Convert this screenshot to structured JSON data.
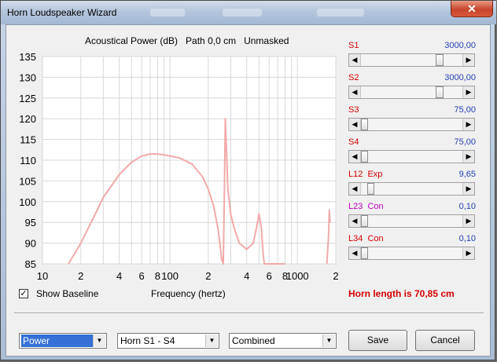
{
  "window": {
    "title": "Horn Loudspeaker Wizard",
    "close_glyph": "✕"
  },
  "chart": {
    "title_line": "Acoustical Power (dB)   Path 0,0 cm   Unmasked",
    "ytick_labels": [
      "135",
      "130",
      "125",
      "120",
      "115",
      "110",
      "105",
      "100",
      "95",
      "90",
      "85"
    ],
    "xtick_labels": [
      "10",
      "2",
      "4",
      "6",
      "8",
      "100",
      "2",
      "4",
      "6",
      "8",
      "1000",
      "2"
    ],
    "curve_color": "#f2a9a9"
  },
  "chart_data": {
    "type": "line",
    "xlabel": "Frequency (hertz)",
    "ylabel": "",
    "xscale": "log",
    "xlim": [
      10,
      2000
    ],
    "ylim": [
      85,
      135
    ],
    "grid": true,
    "series": [
      {
        "x": [
          16,
          20,
          25,
          30,
          40,
          50,
          60,
          70,
          80,
          90,
          100,
          120,
          150,
          180,
          200,
          220,
          240,
          255,
          262,
          268,
          272,
          278,
          285,
          300,
          320,
          350,
          400,
          450,
          480,
          500,
          520,
          540,
          550,
          560,
          570,
          600,
          700,
          800
        ],
        "y": [
          85,
          90,
          96,
          101,
          106.5,
          109.5,
          111,
          111.5,
          111.5,
          111.3,
          111,
          110.5,
          109,
          106,
          103,
          99,
          93,
          86,
          85,
          104,
          120,
          112,
          103,
          97,
          93.5,
          90,
          88.5,
          90,
          94,
          97,
          94,
          87,
          85,
          85,
          85,
          85,
          85,
          85
        ]
      },
      {
        "x": [
          1700,
          1750,
          1780,
          1800
        ],
        "y": [
          85,
          91,
          98,
          95
        ]
      }
    ]
  },
  "sliders": [
    {
      "label": "S1",
      "value": "3000,00",
      "label_color": "#d40000",
      "fraction": 0.79
    },
    {
      "label": "S2",
      "value": "3000,00",
      "label_color": "#d40000",
      "fraction": 0.79
    },
    {
      "label": "S3",
      "value": "75,00",
      "label_color": "#d40000",
      "fraction": 0.0
    },
    {
      "label": "S4",
      "value": "75,00",
      "label_color": "#d40000",
      "fraction": 0.0
    },
    {
      "label": "L12  Exp",
      "value": "9,65",
      "label_color": "#d40000",
      "fraction": 0.07
    },
    {
      "label": "L23  Con",
      "value": "0,10",
      "label_color": "#c000c0",
      "fraction": 0.0
    },
    {
      "label": "L34  Con",
      "value": "0,10",
      "label_color": "#d40000",
      "fraction": 0.0
    }
  ],
  "baseline": {
    "checked": true,
    "check_glyph": "✓",
    "label": "Show Baseline"
  },
  "horn_length_text": "Horn length is 70,85 cm",
  "selects": {
    "mode": "Power",
    "horn": "Horn S1 - S4",
    "view": "Combined"
  },
  "buttons": {
    "save": "Save",
    "cancel": "Cancel"
  }
}
